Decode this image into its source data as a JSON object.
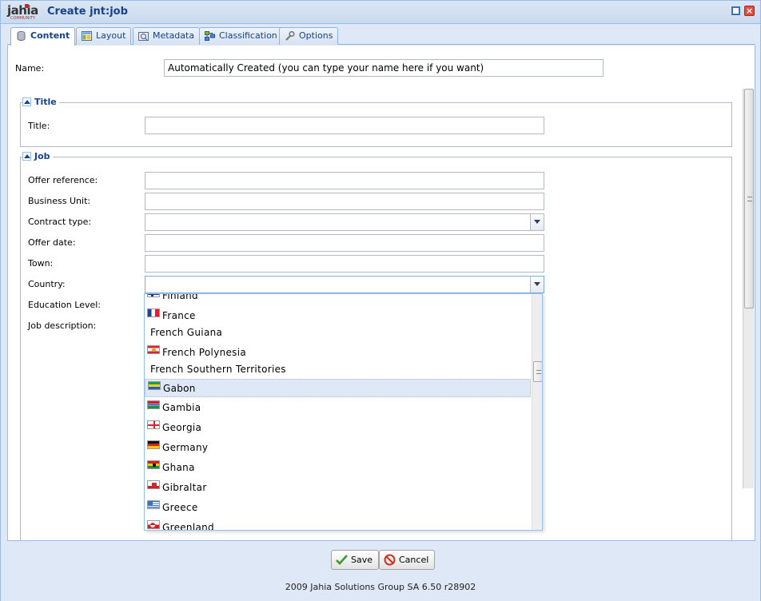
{
  "window": {
    "logo_text": "jahia",
    "logo_subtext": "COMMUNITY",
    "title": "Create jnt:job"
  },
  "tabs": [
    {
      "label": "Content",
      "icon": "database-icon",
      "active": true
    },
    {
      "label": "Layout",
      "icon": "layout-icon",
      "active": false
    },
    {
      "label": "Metadata",
      "icon": "metadata-icon",
      "active": false
    },
    {
      "label": "Classification",
      "icon": "classification-icon",
      "active": false
    },
    {
      "label": "Options",
      "icon": "wrench-icon",
      "active": false
    }
  ],
  "form": {
    "name_label": "Name:",
    "name_value": "Automatically Created (you can type your name here if you want)",
    "title_section": {
      "legend": "Title",
      "title_label": "Title:",
      "title_value": ""
    },
    "job_section": {
      "legend": "Job",
      "offer_reference_label": "Offer reference:",
      "business_unit_label": "Business Unit:",
      "contract_type_label": "Contract type:",
      "offer_date_label": "Offer date:",
      "town_label": "Town:",
      "country_label": "Country:",
      "education_level_label": "Education Level:",
      "job_description_label": "Job description:"
    }
  },
  "country_dropdown": {
    "items": [
      {
        "label": "Finland",
        "flag": "finland"
      },
      {
        "label": "France",
        "flag": "france"
      },
      {
        "label": "French Guiana",
        "flag": ""
      },
      {
        "label": "French Polynesia",
        "flag": "french-polynesia"
      },
      {
        "label": "French Southern Territories",
        "flag": ""
      },
      {
        "label": "Gabon",
        "flag": "gabon",
        "selected": true
      },
      {
        "label": "Gambia",
        "flag": "gambia"
      },
      {
        "label": "Georgia",
        "flag": "georgia"
      },
      {
        "label": "Germany",
        "flag": "germany"
      },
      {
        "label": "Ghana",
        "flag": "ghana"
      },
      {
        "label": "Gibraltar",
        "flag": "gibraltar"
      },
      {
        "label": "Greece",
        "flag": "greece"
      },
      {
        "label": "Greenland",
        "flag": "greenland"
      }
    ]
  },
  "buttons": {
    "save": "Save",
    "cancel": "Cancel"
  },
  "footer": {
    "copyright": "2009 Jahia Solutions Group SA 6.50 r28902"
  },
  "colors": {
    "accent": "#15428b",
    "border": "#99bbe8",
    "selected_row": "#dfe8f6"
  }
}
